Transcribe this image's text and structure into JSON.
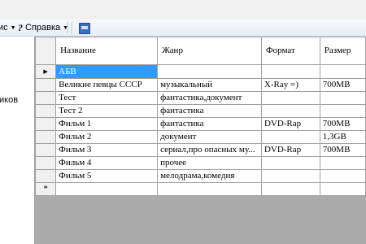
{
  "menu": {
    "partial_item": "ис",
    "help": "Справка",
    "help_glyph": "?",
    "arrow": "▼",
    "toolbar_icon": "table-icon"
  },
  "left_panel": {
    "label": "иков"
  },
  "grid": {
    "columns": [
      "Название",
      "Жанр",
      "Формат",
      "Размер"
    ],
    "current_row_marker": "▶",
    "new_row_marker": "*",
    "rows": [
      {
        "name": "АБВ",
        "genre": "",
        "format": "",
        "size": ""
      },
      {
        "name": "Великие певцы СССР",
        "genre": "музыкальный",
        "format": "X-Ray =)",
        "size": "700MB"
      },
      {
        "name": "Тест",
        "genre": "фантастика,документ",
        "format": "",
        "size": ""
      },
      {
        "name": "Тест 2",
        "genre": "фантастика",
        "format": "",
        "size": ""
      },
      {
        "name": "Фильм 1",
        "genre": "фантастика",
        "format": "DVD-Rap",
        "size": "700MB"
      },
      {
        "name": "Фильм 2",
        "genre": "документ",
        "format": "",
        "size": "1,3GB"
      },
      {
        "name": "Фильм 3",
        "genre": "сериал,про опасных му...",
        "format": "DVD-Rap",
        "size": "700MB"
      },
      {
        "name": "Фильм 4",
        "genre": "прочее",
        "format": "",
        "size": ""
      },
      {
        "name": "Фильм 5",
        "genre": "мелодрама,комедия",
        "format": "",
        "size": ""
      }
    ]
  }
}
